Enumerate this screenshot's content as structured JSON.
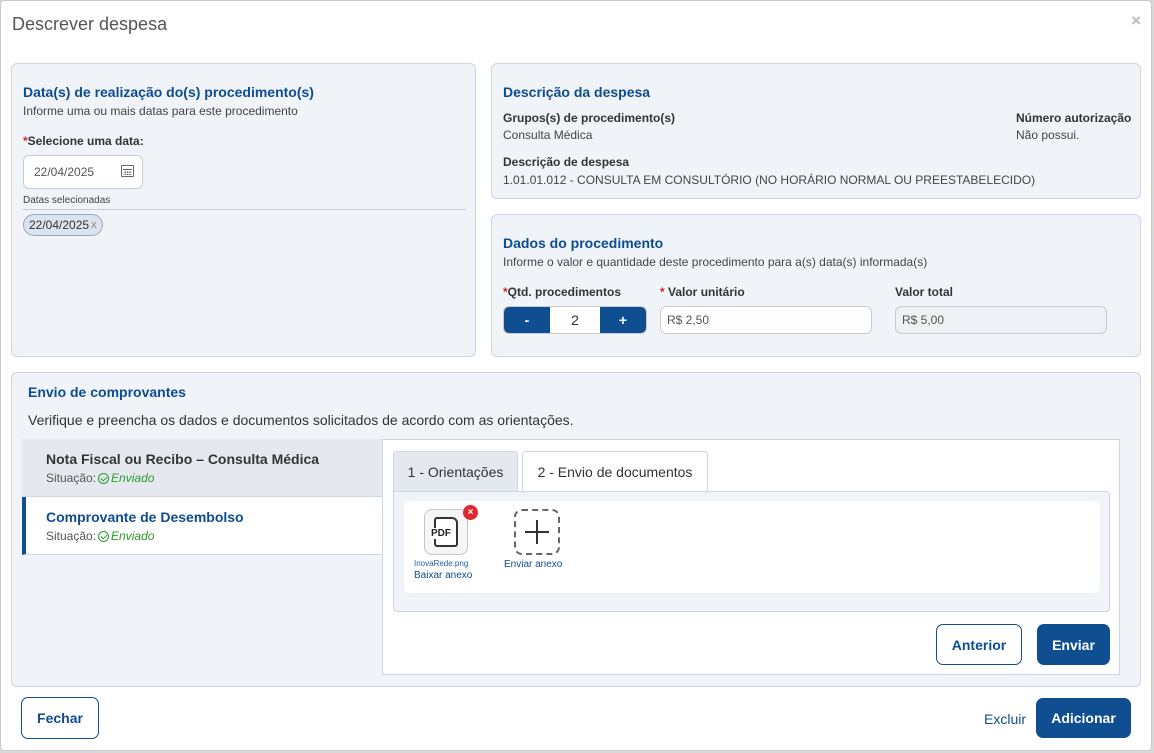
{
  "modal": {
    "title": "Descrever despesa",
    "close": "×"
  },
  "dates_panel": {
    "title": "Data(s) de realização do(s) procedimento(s)",
    "subtitle": "Informe uma ou mais datas para este procedimento",
    "required_mark": "*",
    "select_label": "Selecione uma data:",
    "date_value": "22/04/2025",
    "selected_label": "Datas selecionadas",
    "chips": [
      {
        "label": "22/04/2025",
        "remove": "x"
      }
    ]
  },
  "expense_panel": {
    "title": "Descrição da despesa",
    "group_label": "Grupos(s) de procedimento(s)",
    "group_value": "Consulta Médica",
    "auth_label": "Número autorização",
    "auth_value": "Não possui.",
    "desc_label": "Descrição de despesa",
    "desc_value": "1.01.01.012 - CONSULTA EM CONSULTÓRIO (NO HORÁRIO NORMAL OU PREESTABELECIDO)"
  },
  "procedure_panel": {
    "title": "Dados do procedimento",
    "subtitle": "Informe o valor e quantidade deste procedimento para a(s) data(s) informada(s)",
    "required_mark": "*",
    "qty_label": "Qtd. procedimentos",
    "minus": "-",
    "qty_value": "2",
    "plus": "+",
    "unit_label": " Valor unitário",
    "unit_value": "R$ 2,50",
    "total_label": "Valor total",
    "total_value": "R$ 5,00"
  },
  "receipts": {
    "title": "Envio de comprovantes",
    "instructions": "Verifique e preencha os dados e documentos solicitados de acordo com as orientações.",
    "status_label": "Situação:",
    "items": [
      {
        "title": "Nota Fiscal ou Recibo – Consulta Médica",
        "status": "Enviado"
      },
      {
        "title": "Comprovante de Desembolso",
        "status": "Enviado"
      }
    ],
    "tabs": [
      {
        "label": "1 - Orientações"
      },
      {
        "label": "2 - Envio de documentos"
      }
    ],
    "file": {
      "type_text": "PDF",
      "name": "InovaRede.png",
      "download": "Baixar anexo",
      "remove": "×"
    },
    "add_label": "Enviar anexo",
    "prev_button": "Anterior",
    "send_button": "Enviar"
  },
  "footer": {
    "close_button": "Fechar",
    "delete_link": "Excluir",
    "add_button": "Adicionar"
  },
  "colors": {
    "primary": "#0f4f91",
    "title_blue": "#0d4c8f",
    "success": "#2c9a2c",
    "danger": "#e3262e",
    "panel_bg": "#f0f3f8"
  }
}
